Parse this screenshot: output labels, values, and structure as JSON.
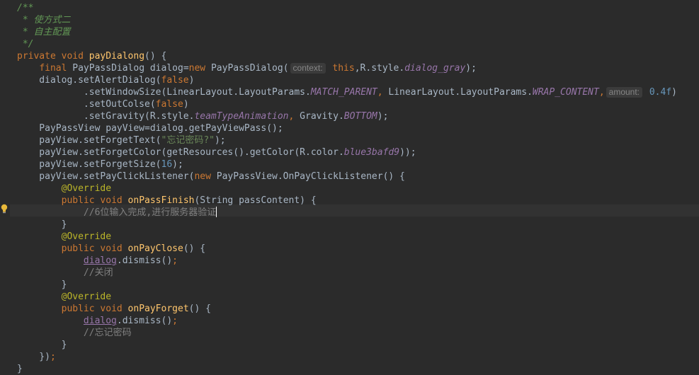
{
  "editor": {
    "lines": [
      [
        [
          "doc",
          "/**"
        ]
      ],
      [
        [
          "doc",
          " * 使方式二"
        ]
      ],
      [
        [
          "doc",
          " * 自主配置"
        ]
      ],
      [
        [
          "doc",
          " */"
        ]
      ],
      [
        [
          "kw",
          "private void "
        ],
        [
          "fn",
          "payDialong"
        ],
        [
          "t",
          "() {"
        ]
      ],
      [
        [
          "t",
          "    "
        ],
        [
          "kw",
          "final "
        ],
        [
          "t",
          "PayPassDialog dialog="
        ],
        [
          "kw",
          "new "
        ],
        [
          "t",
          "PayPassDialog("
        ],
        [
          "hint",
          "context:"
        ],
        [
          "kw",
          " this"
        ],
        [
          "t",
          ",R.style."
        ],
        [
          "cst",
          "dialog_gray"
        ],
        [
          "t",
          ");"
        ]
      ],
      [
        [
          "t",
          "    dialog.setAlertDialog("
        ],
        [
          "kw",
          "false"
        ],
        [
          "t",
          ")"
        ]
      ],
      [
        [
          "t",
          "            .setWindowSize(LinearLayout.LayoutParams."
        ],
        [
          "cst",
          "MATCH_PARENT"
        ],
        [
          "kw",
          ", "
        ],
        [
          "t",
          "LinearLayout.LayoutParams."
        ],
        [
          "cst",
          "WRAP_CONTENT"
        ],
        [
          "kw",
          ","
        ],
        [
          "hint",
          "amount:"
        ],
        [
          "num",
          " 0.4f"
        ],
        [
          "t",
          ")"
        ]
      ],
      [
        [
          "t",
          "            .setOutColse("
        ],
        [
          "kw",
          "false"
        ],
        [
          "t",
          ")"
        ]
      ],
      [
        [
          "t",
          "            .setGravity(R.style."
        ],
        [
          "cst",
          "teamTypeAnimation"
        ],
        [
          "kw",
          ", "
        ],
        [
          "t",
          "Gravity."
        ],
        [
          "cst",
          "BOTTOM"
        ],
        [
          "t",
          ");"
        ]
      ],
      [
        [
          "t",
          "    PayPassView payView=dialog.getPayViewPass();"
        ]
      ],
      [
        [
          "t",
          "    payView.setForgetText("
        ],
        [
          "str",
          "\"忘记密码?\""
        ],
        [
          "t",
          ");"
        ]
      ],
      [
        [
          "t",
          "    payView.setForgetColor(getResources().getColor(R.color."
        ],
        [
          "cst",
          "blue3bafd9"
        ],
        [
          "t",
          "));"
        ]
      ],
      [
        [
          "t",
          "    payView.setForgetSize("
        ],
        [
          "num",
          "16"
        ],
        [
          "t",
          ");"
        ]
      ],
      [
        [
          "t",
          "    payView.setPayClickListener("
        ],
        [
          "kw",
          "new "
        ],
        [
          "t",
          "PayPassView.OnPayClickListener() {"
        ]
      ],
      [
        [
          "t",
          "        "
        ],
        [
          "ann",
          "@Override"
        ]
      ],
      [
        [
          "t",
          "        "
        ],
        [
          "kw",
          "public void "
        ],
        [
          "fn",
          "onPassFinish"
        ],
        [
          "t",
          "(String passContent) {"
        ]
      ],
      [
        [
          "t",
          "            "
        ],
        [
          "cmt",
          "//6位输入完成,进行服务器验证"
        ],
        [
          "cursor",
          ""
        ]
      ],
      [
        [
          "t",
          "        }"
        ]
      ],
      [
        [
          "t",
          "        "
        ],
        [
          "ann",
          "@Override"
        ]
      ],
      [
        [
          "t",
          "        "
        ],
        [
          "kw",
          "public void "
        ],
        [
          "fn",
          "onPayClose"
        ],
        [
          "t",
          "() {"
        ]
      ],
      [
        [
          "t",
          "            "
        ],
        [
          "udl",
          "dialog"
        ],
        [
          "t",
          ".dismiss()"
        ],
        [
          "kw",
          ";"
        ]
      ],
      [
        [
          "t",
          "            "
        ],
        [
          "cmt",
          "//关闭"
        ]
      ],
      [
        [
          "t",
          "        }"
        ]
      ],
      [
        [
          "t",
          "        "
        ],
        [
          "ann",
          "@Override"
        ]
      ],
      [
        [
          "t",
          "        "
        ],
        [
          "kw",
          "public void "
        ],
        [
          "fn",
          "onPayForget"
        ],
        [
          "t",
          "() {"
        ]
      ],
      [
        [
          "t",
          "            "
        ],
        [
          "udl",
          "dialog"
        ],
        [
          "t",
          ".dismiss()"
        ],
        [
          "kw",
          ";"
        ]
      ],
      [
        [
          "t",
          "            "
        ],
        [
          "cmt",
          "//忘记密码"
        ]
      ],
      [
        [
          "t",
          "        }"
        ]
      ],
      [
        [
          "t",
          "    })"
        ],
        [
          "kw",
          ";"
        ]
      ],
      [
        [
          "t",
          "}"
        ]
      ]
    ],
    "colors": {
      "background": "#2b2b2b",
      "keyword": "#cc7832",
      "method": "#ffc66d",
      "string": "#6a8759",
      "number": "#6897bb",
      "constant": "#9876aa",
      "annotation": "#bbb529",
      "comment": "#808080",
      "doc_comment": "#629755",
      "text": "#a9b7c6"
    },
    "gutter_icon": "lightbulb-icon"
  }
}
